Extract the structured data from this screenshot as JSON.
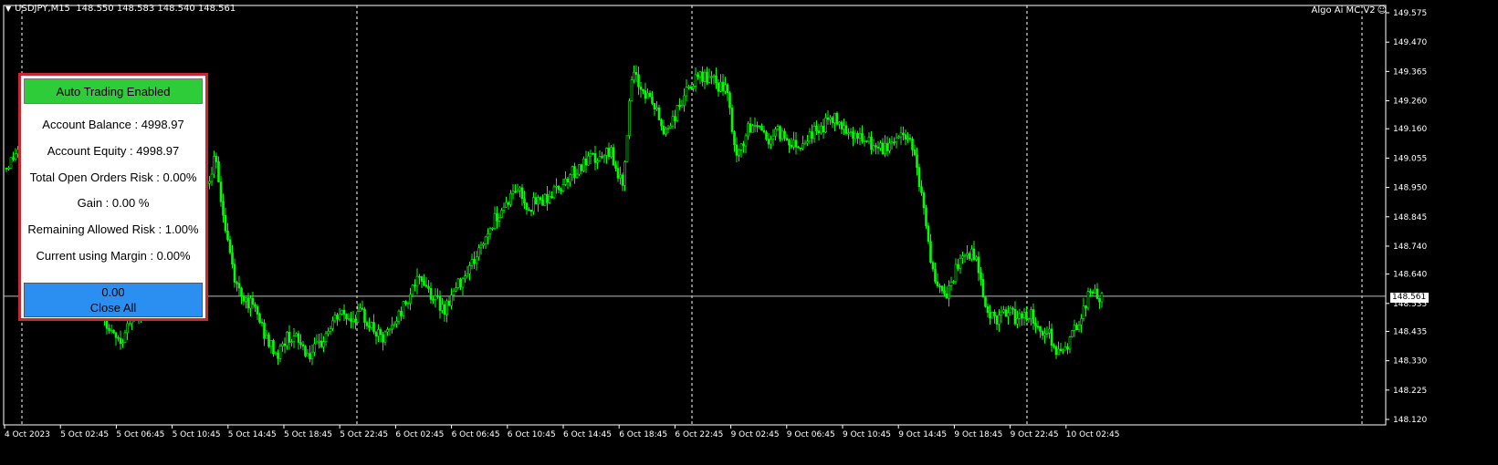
{
  "symbol_header": {
    "symbol": "USDJPY,M15",
    "ohlc": "148.550 148.583 148.540 148.561"
  },
  "ea_label": "Algo Ai MC V2",
  "current_price": "148.561",
  "panel": {
    "auto_trading_label": "Auto Trading Enabled",
    "lines": [
      "Account Balance : 4998.97",
      "Account Equity : 4998.97",
      "Total Open Orders Risk : 0.00%",
      "Gain : 0.00 %",
      "Remaining Allowed Risk : 1.00%",
      "Current using Margin : 0.00%"
    ],
    "close_all_value": "0.00",
    "close_all_label": "Close All"
  },
  "colors": {
    "background": "#000000",
    "candle": "#00ff00",
    "grid": "#ffffff",
    "panel_border": "#c8282f",
    "auto_trading_bg": "#2fcc3a",
    "close_all_bg": "#2b8ff2"
  },
  "chart_data": {
    "type": "candlestick",
    "y_ticks": [
      "149.575",
      "149.470",
      "149.365",
      "149.260",
      "149.160",
      "149.055",
      "148.950",
      "148.845",
      "148.740",
      "148.640",
      "148.535",
      "148.435",
      "148.330",
      "148.225",
      "148.120"
    ],
    "ylim": [
      148.12,
      149.575
    ],
    "x_ticks": [
      "4 Oct 2023",
      "5 Oct 02:45",
      "5 Oct 06:45",
      "5 Oct 10:45",
      "5 Oct 14:45",
      "5 Oct 18:45",
      "5 Oct 22:45",
      "6 Oct 02:45",
      "6 Oct 06:45",
      "6 Oct 10:45",
      "6 Oct 14:45",
      "6 Oct 18:45",
      "6 Oct 22:45",
      "9 Oct 02:45",
      "9 Oct 06:45",
      "9 Oct 10:45",
      "9 Oct 14:45",
      "9 Oct 18:45",
      "9 Oct 22:45",
      "10 Oct 02:45"
    ],
    "price_path": [
      149.02,
      149.08,
      149.12,
      149.1,
      148.98,
      148.92,
      148.85,
      148.8,
      148.7,
      148.55,
      148.42,
      148.4,
      148.48,
      148.52,
      148.55,
      148.6,
      148.7,
      148.85,
      148.9,
      148.95,
      149.05,
      148.8,
      148.6,
      148.55,
      148.5,
      148.4,
      148.35,
      148.42,
      148.4,
      148.35,
      148.38,
      148.45,
      148.5,
      148.48,
      148.5,
      148.45,
      148.4,
      148.45,
      148.52,
      148.6,
      148.62,
      148.55,
      148.52,
      148.58,
      148.65,
      148.7,
      148.78,
      148.85,
      148.9,
      148.95,
      148.88,
      148.9,
      148.92,
      148.95,
      149.0,
      149.02,
      149.05,
      149.05,
      149.08,
      148.95,
      149.35,
      149.3,
      149.25,
      149.15,
      149.2,
      149.28,
      149.33,
      149.35,
      149.32,
      149.3,
      149.05,
      149.15,
      149.18,
      149.12,
      149.15,
      149.12,
      149.1,
      149.14,
      149.16,
      149.2,
      149.18,
      149.15,
      149.12,
      149.1,
      149.08,
      149.12,
      149.14,
      149.1,
      148.85,
      148.6,
      148.55,
      148.65,
      148.72,
      148.7,
      148.5,
      148.48,
      148.5,
      148.48,
      148.5,
      148.45,
      148.42,
      148.35,
      148.4,
      148.5,
      148.58,
      148.55
    ],
    "current_price": 148.561,
    "grid": "vertical dashed session separators"
  }
}
